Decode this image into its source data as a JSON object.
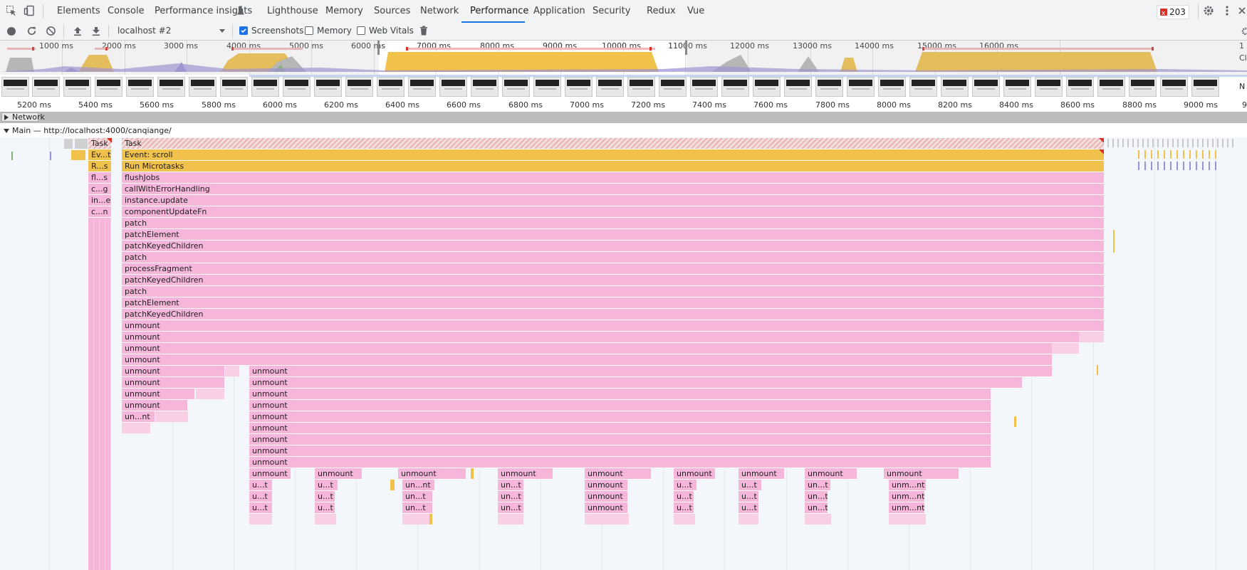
{
  "tabs": [
    "Elements",
    "Console",
    "Performance insights",
    "Lighthouse",
    "Memory",
    "Sources",
    "Network",
    "Performance",
    "Application",
    "Security",
    "Redux",
    "Vue"
  ],
  "active_tab": "Performance",
  "issues_count": "203",
  "toolbar": {
    "target": "localhost #2",
    "screenshots_label": "Screenshots",
    "memory_label": "Memory",
    "webvitals_label": "Web Vitals"
  },
  "overview_labels": [
    "1000 ms",
    "2000 ms",
    "3000 ms",
    "4000 ms",
    "5000 ms",
    "6000 ms",
    "7000 ms",
    "8000 ms",
    "9000 ms",
    "10000 ms",
    "11000 ms",
    "12000 ms",
    "13000 ms",
    "14000 ms",
    "15000 ms",
    "16000 ms"
  ],
  "overview_right": [
    "1",
    "Cl"
  ],
  "shots_right": "N",
  "ruler_labels": [
    "5200 ms",
    "5400 ms",
    "5600 ms",
    "5800 ms",
    "6000 ms",
    "6200 ms",
    "6400 ms",
    "6600 ms",
    "6800 ms",
    "7000 ms",
    "7200 ms",
    "7400 ms",
    "7600 ms",
    "7800 ms",
    "8000 ms",
    "8200 ms",
    "8400 ms",
    "8600 ms",
    "8800 ms",
    "9000 ms",
    "9"
  ],
  "network_track": "Network",
  "main_track": "Main — http://localhost:4000/canqiange/",
  "left_stack": [
    "Task",
    "Ev...t",
    "R...s",
    "fl...s",
    "c...g",
    "in...e",
    "c...n"
  ],
  "main_stack": [
    "Task",
    "Event: scroll",
    "Run Microtasks",
    "flushJobs",
    "callWithErrorHandling",
    "instance.update",
    "componentUpdateFn",
    "patch",
    "patchElement",
    "patchKeyedChildren",
    "patch",
    "processFragment",
    "patchKeyedChildren",
    "patch",
    "patchElement",
    "patchKeyedChildren",
    "unmount",
    "unmount",
    "unmount",
    "unmount",
    "unmount",
    "unmount",
    "unmount",
    "unmount",
    "un...nt"
  ],
  "mid_stack": [
    "unmount",
    "unmount",
    "unmount",
    "unmount",
    "unmount",
    "unmount",
    "unmount",
    "unmount",
    "unmount"
  ],
  "bottom_unmounts": [
    "unmount",
    "unmount",
    "unmount",
    "unmount",
    "unmount",
    "unmount",
    "unmount",
    "unmount",
    "unmount"
  ],
  "bottom_row2": [
    "u...t",
    "u...t",
    "un...nt",
    "un...t",
    "unmount",
    "u...t",
    "u...t",
    "un...t",
    "unm...nt"
  ],
  "bottom_row3": [
    "u...t",
    "u...t",
    "un...t",
    "un...t",
    "unmount",
    "u...t",
    "u...t",
    "un...t",
    "unm...nt"
  ],
  "bottom_row4": [
    "u...t",
    "u...t",
    "un...t",
    "un...t",
    "unmount",
    "u...t",
    "u...t",
    "un...t",
    "unm...nt"
  ]
}
